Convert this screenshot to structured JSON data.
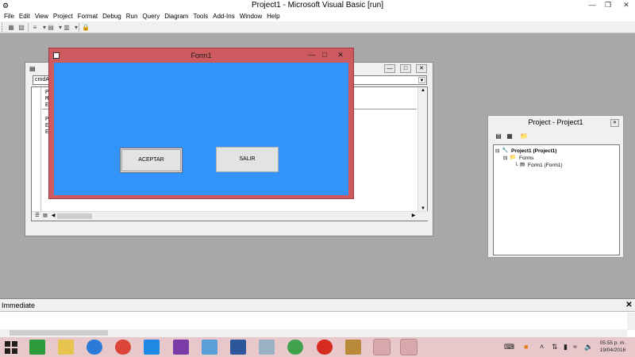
{
  "window": {
    "title": "Project1 - Microsoft Visual Basic [run]",
    "minimize": "—",
    "restore": "❐",
    "close": "✕"
  },
  "menu": [
    "File",
    "Edit",
    "View",
    "Project",
    "Format",
    "Debug",
    "Run",
    "Query",
    "Diagram",
    "Tools",
    "Add-Ins",
    "Window",
    "Help"
  ],
  "code_window": {
    "object_combo": "cmdA",
    "lines": [
      "P",
      "M",
      "E",
      "P",
      "E",
      "E"
    ]
  },
  "form": {
    "title": "Form1",
    "aceptar_label": "ACEPTAR",
    "salir_label": "SALIR",
    "background": "#3293fd"
  },
  "project_explorer": {
    "title": "Project - Project1",
    "tree": {
      "project": "Project1 (Project1)",
      "folder": "Forms",
      "form": "Form1 (Form1)"
    }
  },
  "immediate": {
    "title": "Immediate",
    "close": "✕"
  },
  "taskbar": {
    "time": "05:55 p. m.",
    "date": "19/04/2016"
  }
}
